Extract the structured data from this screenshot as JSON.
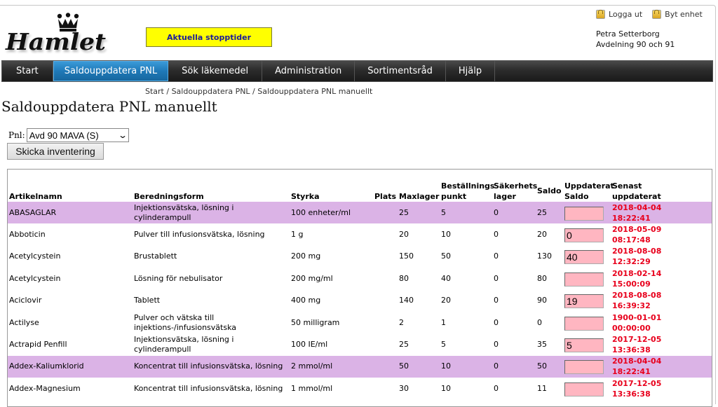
{
  "header": {
    "logo_text": "Hamlet",
    "stop_times_button": "Aktuella stopptider",
    "logout_label": "Logga ut",
    "switch_unit_label": "Byt enhet",
    "user_name": "Petra Setterborg",
    "user_unit": "Avdelning 90 och 91"
  },
  "nav": {
    "items": [
      {
        "label": "Start",
        "active": false
      },
      {
        "label": "Saldouppdatera PNL",
        "active": true
      },
      {
        "label": "Sök läkemedel",
        "active": false
      },
      {
        "label": "Administration",
        "active": false
      },
      {
        "label": "Sortimentsråd",
        "active": false
      },
      {
        "label": "Hjälp",
        "active": false
      }
    ]
  },
  "breadcrumb": "Start / Saldouppdatera PNL / Saldouppdatera PNL manuellt",
  "page_title": "Saldouppdatera PNL manuellt",
  "form": {
    "pnl_label": "Pnl:",
    "pnl_selected": "Avd 90 MAVA (S)",
    "send_button": "Skicka inventering"
  },
  "table": {
    "headers": {
      "artikelnamn": "Artikelnamn",
      "beredningsform": "Beredningsform",
      "styrka": "Styrka",
      "plats": "Plats",
      "maxlager": "Maxlager",
      "bestallningspunkt_1": "Beställnings",
      "bestallningspunkt_2": "punkt",
      "sakerhetslager_1": "Säkerhets",
      "sakerhetslager_2": "lager",
      "saldo": "Saldo",
      "uppdaterat_saldo_1": "Uppdaterat",
      "uppdaterat_saldo_2": "Saldo",
      "senast_uppdaterat_1": "Senast",
      "senast_uppdaterat_2": "uppdaterat"
    },
    "rows": [
      {
        "name": "ABASAGLAR",
        "form": "Injektionsvätska, lösning i cylinderampull",
        "strength": "100 enheter/ml",
        "plats": "",
        "maxlager": "25",
        "bp": "5",
        "sl": "0",
        "saldo": "25",
        "updated_saldo": "",
        "date": "2018-04-04",
        "time": "18:22:41",
        "highlight": true
      },
      {
        "name": "Abboticin",
        "form": "Pulver till infusionsvätska, lösning",
        "strength": "1 g",
        "plats": "",
        "maxlager": "20",
        "bp": "10",
        "sl": "0",
        "saldo": "20",
        "updated_saldo": "0",
        "date": "2018-05-09",
        "time": "08:17:48",
        "highlight": false
      },
      {
        "name": "Acetylcystein",
        "form": "Brustablett",
        "strength": "200 mg",
        "plats": "",
        "maxlager": "150",
        "bp": "50",
        "sl": "0",
        "saldo": "130",
        "updated_saldo": "40",
        "date": "2018-08-08",
        "time": "12:32:29",
        "highlight": false
      },
      {
        "name": "Acetylcystein",
        "form": "Lösning för nebulisator",
        "strength": "200 mg/ml",
        "plats": "",
        "maxlager": "80",
        "bp": "40",
        "sl": "0",
        "saldo": "80",
        "updated_saldo": "",
        "date": "2018-02-14",
        "time": "15:00:09",
        "highlight": false
      },
      {
        "name": "Aciclovir",
        "form": "Tablett",
        "strength": "400 mg",
        "plats": "",
        "maxlager": "140",
        "bp": "20",
        "sl": "0",
        "saldo": "90",
        "updated_saldo": "19",
        "date": "2018-08-08",
        "time": "16:39:32",
        "highlight": false
      },
      {
        "name": "Actilyse",
        "form": "Pulver och vätska till injektions-/infusionsvätska",
        "strength": "50 milligram",
        "plats": "",
        "maxlager": "2",
        "bp": "1",
        "sl": "0",
        "saldo": "0",
        "updated_saldo": "",
        "date": "1900-01-01",
        "time": "00:00:00",
        "highlight": false
      },
      {
        "name": "Actrapid Penfill",
        "form": "Injektionsvätska, lösning i cylinderampull",
        "strength": "100 IE/ml",
        "plats": "",
        "maxlager": "25",
        "bp": "5",
        "sl": "0",
        "saldo": "35",
        "updated_saldo": "5",
        "date": "2017-12-05",
        "time": "13:36:38",
        "highlight": false
      },
      {
        "name": "Addex-Kaliumklorid",
        "form": "Koncentrat till infusionsvätska, lösning",
        "strength": "2 mmol/ml",
        "plats": "",
        "maxlager": "50",
        "bp": "10",
        "sl": "0",
        "saldo": "50",
        "updated_saldo": "",
        "date": "2018-04-04",
        "time": "18:22:41",
        "highlight": true
      },
      {
        "name": "Addex-Magnesium",
        "form": "Koncentrat till infusionsvätska, lösning",
        "strength": "1 mmol/ml",
        "plats": "",
        "maxlager": "30",
        "bp": "10",
        "sl": "0",
        "saldo": "11",
        "updated_saldo": "",
        "date": "2017-12-05",
        "time": "13:36:38",
        "highlight": false
      }
    ]
  },
  "colors": {
    "highlight_row": "#dbb3e6",
    "timestamp": "#e8001c",
    "input_bg": "#ffb6c1",
    "nav_active": "#1f79b8",
    "stop_button_bg": "#ffff00"
  }
}
